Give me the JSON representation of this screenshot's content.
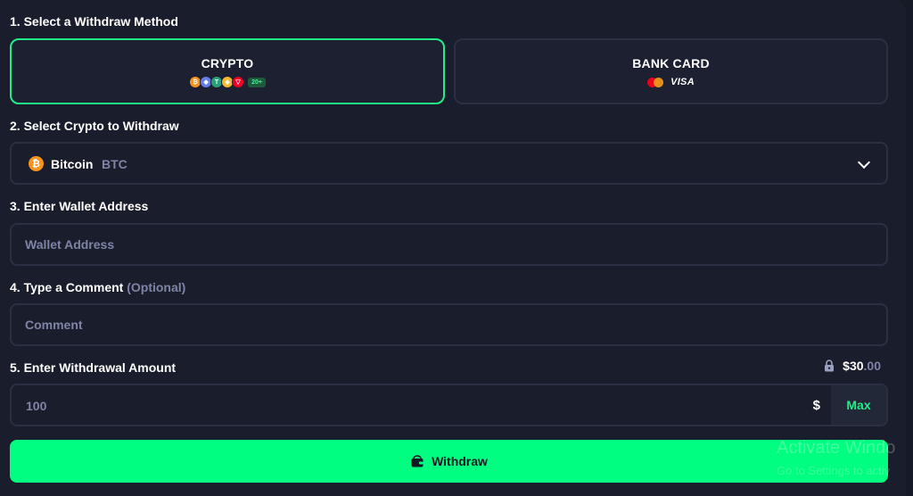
{
  "sections": {
    "method": "1. Select a Withdraw Method",
    "crypto": "2. Select Crypto to Withdraw",
    "wallet": "3. Enter Wallet Address",
    "comment": "4. Type a Comment",
    "comment_optional": "(Optional)",
    "amount": "5. Enter Withdrawal Amount"
  },
  "methods": {
    "crypto": {
      "label": "CRYPTO",
      "more_badge": "20+",
      "selected": true
    },
    "bank": {
      "label": "BANK CARD",
      "visa_label": "VISA",
      "selected": false
    }
  },
  "coin_icons": [
    {
      "icon": "bitcoin-icon",
      "glyph": "₿",
      "color": "#f7931a"
    },
    {
      "icon": "ethereum-icon",
      "glyph": "◆",
      "color": "#627eea"
    },
    {
      "icon": "tether-icon",
      "glyph": "T",
      "color": "#26a17b"
    },
    {
      "icon": "bnb-icon",
      "glyph": "◈",
      "color": "#f3ba2f"
    },
    {
      "icon": "tron-icon",
      "glyph": "▽",
      "color": "#ef0027"
    }
  ],
  "selected_crypto": {
    "name": "Bitcoin",
    "ticker": "BTC",
    "glyph": "₿"
  },
  "wallet_input": {
    "placeholder": "Wallet Address",
    "value": ""
  },
  "comment_input": {
    "placeholder": "Comment",
    "value": ""
  },
  "amount": {
    "value": "100",
    "currency_symbol": "$",
    "max_label": "Max",
    "balance_main": "$30",
    "balance_decimals": ".00"
  },
  "withdraw_button": {
    "label": "Withdraw"
  },
  "watermark": {
    "title": "Activate Windo",
    "subtitle": "Go to Settings to activ"
  },
  "colors": {
    "accent": "#00ff80",
    "accent_border": "#22ee88",
    "background": "#1a1e2c",
    "muted": "#7f84a6"
  }
}
